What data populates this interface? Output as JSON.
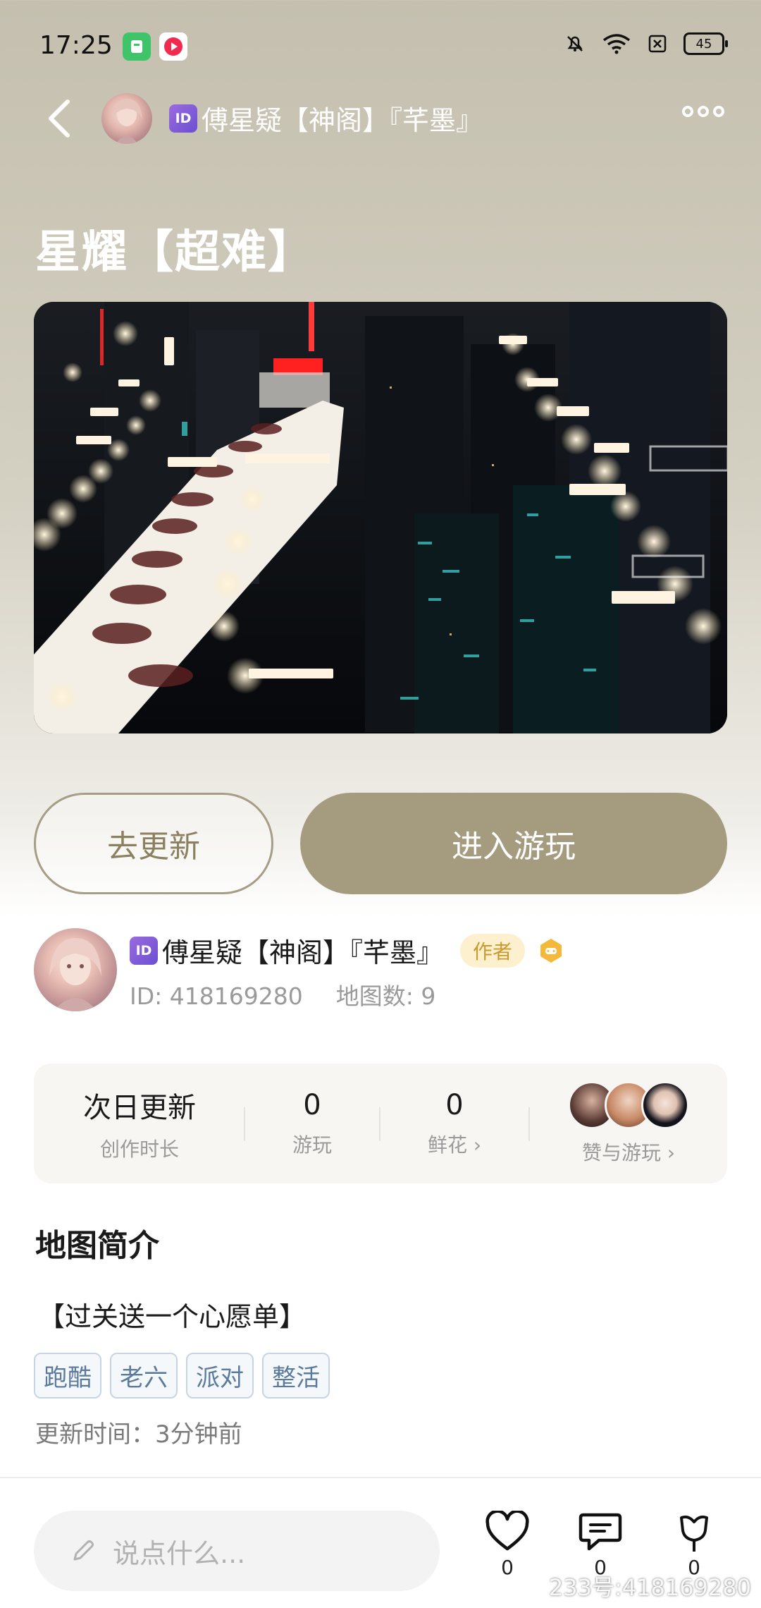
{
  "status_bar": {
    "time": "17:25",
    "battery": "45"
  },
  "header": {
    "id_badge": "ID",
    "title": "傅星疑【神阁】『芊墨』"
  },
  "map": {
    "title": "星耀【超难】"
  },
  "actions": {
    "update_label": "去更新",
    "play_label": "进入游玩"
  },
  "author": {
    "id_badge": "ID",
    "name": "傅星疑【神阁】『芊墨』",
    "tag": "作者",
    "id_text": "ID: 418169280",
    "map_count": "地图数: 9"
  },
  "stats": {
    "update_value": "次日更新",
    "update_label": "创作时长",
    "plays_value": "0",
    "plays_label": "游玩",
    "flowers_value": "0",
    "flowers_label": "鲜花",
    "likes_label": "赞与游玩"
  },
  "intro": {
    "section_title": "地图简介",
    "description": "【过关送一个心愿单】",
    "tags": [
      "跑酷",
      "老六",
      "派对",
      "整活"
    ],
    "update_time": "更新时间：3分钟前"
  },
  "bottom_bar": {
    "comment_placeholder": "说点什么...",
    "like_count": "0",
    "comment_count": "0",
    "flower_count": "0"
  },
  "watermark": "233号:418169280",
  "colors": {
    "accent": "#a59c80",
    "author_tag_bg": "#fdf0cf",
    "tag_text": "#5b7a9c"
  },
  "icons": {
    "back": "chevron-left-icon",
    "more": "more-icon",
    "like": "heart-icon",
    "comment": "comment-icon",
    "flower": "flower-icon",
    "edit": "pencil-icon"
  }
}
